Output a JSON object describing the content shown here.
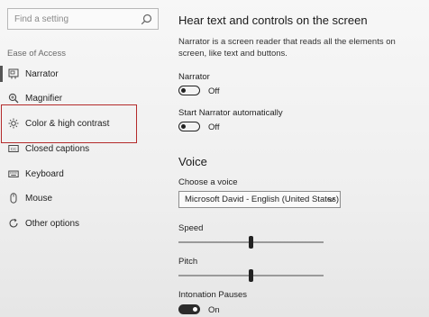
{
  "sidebar": {
    "search_placeholder": "Find a setting",
    "section_label": "Ease of Access",
    "items": [
      {
        "label": "Narrator",
        "icon": "narrator-icon"
      },
      {
        "label": "Magnifier",
        "icon": "magnifier-icon"
      },
      {
        "label": "Color & high contrast",
        "icon": "brightness-icon",
        "highlighted": true
      },
      {
        "label": "Closed captions",
        "icon": "captions-icon"
      },
      {
        "label": "Keyboard",
        "icon": "keyboard-icon"
      },
      {
        "label": "Mouse",
        "icon": "mouse-icon"
      },
      {
        "label": "Other options",
        "icon": "refresh-icon"
      }
    ],
    "highlight_color": "#b42a2a"
  },
  "main": {
    "section_title": "Hear text and controls on the screen",
    "description": "Narrator is a screen reader that reads all the elements on screen, like text and buttons.",
    "narrator": {
      "label": "Narrator",
      "state": "Off"
    },
    "start_auto": {
      "label": "Start Narrator automatically",
      "state": "Off"
    },
    "voice": {
      "title": "Voice",
      "choose_label": "Choose a voice",
      "selected_voice": "Microsoft David - English (United States)"
    },
    "speed": {
      "label": "Speed",
      "value_fraction": 0.5
    },
    "pitch": {
      "label": "Pitch",
      "value_fraction": 0.5
    },
    "intonation": {
      "label": "Intonation Pauses",
      "state": "On"
    }
  }
}
